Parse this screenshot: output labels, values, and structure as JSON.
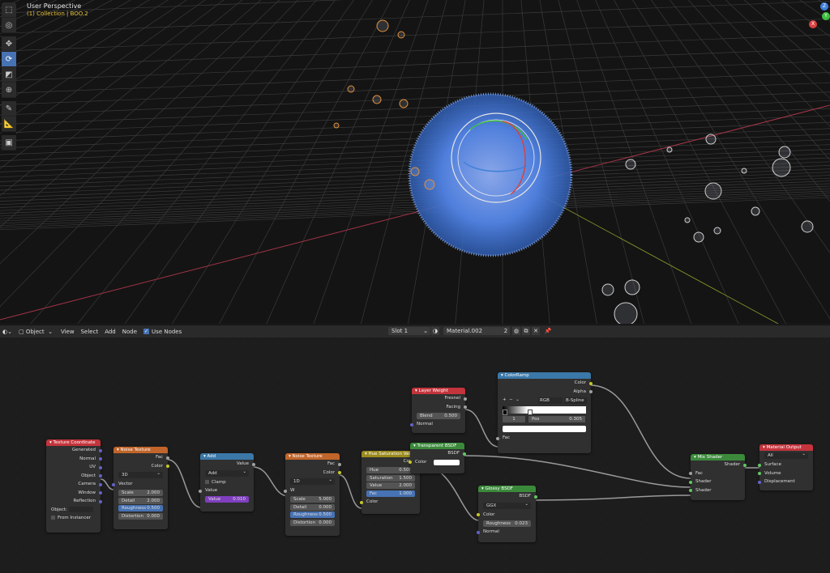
{
  "viewport": {
    "title": "User Perspective",
    "subtitle": "(1) Collection | BOO.2",
    "axis_x": "X",
    "axis_y": "Y",
    "axis_z": "Z"
  },
  "toolbar_icons": [
    "select-box-icon",
    "cursor-icon",
    "move-icon",
    "rotate-icon",
    "scale-icon",
    "transform-icon",
    "annotate-icon",
    "measure-icon",
    "add-cube-icon"
  ],
  "editor_header": {
    "mode": "Object",
    "menu": [
      "View",
      "Select",
      "Add",
      "Node"
    ],
    "use_nodes": "Use Nodes",
    "slot": "Slot 1",
    "material": "Material.002",
    "users": "2"
  },
  "nodes": {
    "texcoord": {
      "title": "Texture Coordinate",
      "outputs": [
        "Generated",
        "Normal",
        "UV",
        "Object",
        "Camera",
        "Window",
        "Reflection"
      ],
      "object_label": "Object:",
      "from_instancer": "From Instancer"
    },
    "noise1": {
      "title": "Noise Texture",
      "outputs": [
        "Fac",
        "Color"
      ],
      "dim": "3D",
      "input": "Vector",
      "scale_l": "Scale",
      "scale_v": "2.000",
      "detail_l": "Detail",
      "detail_v": "2.000",
      "rough_l": "Roughness",
      "rough_v": "0.500",
      "dist_l": "Distortion",
      "dist_v": "0.000"
    },
    "add": {
      "title": "Add",
      "output": "Value",
      "op": "Add",
      "clamp": "Clamp",
      "input": "Value",
      "val_l": "Value",
      "val_v": "0.010"
    },
    "noise2": {
      "title": "Noise Texture",
      "outputs": [
        "Fac",
        "Color"
      ],
      "dim": "1D",
      "input": "W",
      "scale_l": "Scale",
      "scale_v": "5.000",
      "detail_l": "Detail",
      "detail_v": "0.000",
      "rough_l": "Roughness",
      "rough_v": "0.500",
      "dist_l": "Distortion",
      "dist_v": "0.000"
    },
    "huesat": {
      "title": "Hue Saturation Value",
      "output": "Color",
      "hue_l": "Hue",
      "hue_v": "0.500",
      "sat_l": "Saturation",
      "sat_v": "1.500",
      "val_l": "Value",
      "val_v": "2.000",
      "fac_l": "Fac",
      "fac_v": "1.000",
      "input": "Color"
    },
    "layerweight": {
      "title": "Layer Weight",
      "outputs": [
        "Fresnel",
        "Facing"
      ],
      "blend_l": "Blend",
      "blend_v": "0.500",
      "input": "Normal"
    },
    "transparent": {
      "title": "Transparent BSDF",
      "output": "BSDF",
      "input": "Color"
    },
    "colorramp": {
      "title": "ColorRamp",
      "outputs": [
        "Color",
        "Alpha"
      ],
      "plus": "+",
      "minus": "−",
      "chev": "⌄",
      "mode": "RGB",
      "interp": "B-Spline",
      "index": "1",
      "pos_l": "Pos",
      "pos_v": "0.305",
      "input": "Fac"
    },
    "glossy": {
      "title": "Glossy BSDF",
      "output": "BSDF",
      "dist": "GGX",
      "in_color": "Color",
      "rough_l": "Roughness",
      "rough_v": "0.023",
      "in_normal": "Normal"
    },
    "mix": {
      "title": "Mix Shader",
      "output": "Shader",
      "inputs": [
        "Fac",
        "Shader",
        "Shader"
      ]
    },
    "matout": {
      "title": "Material Output",
      "target": "All",
      "inputs": [
        "Surface",
        "Volume",
        "Displacement"
      ]
    }
  }
}
